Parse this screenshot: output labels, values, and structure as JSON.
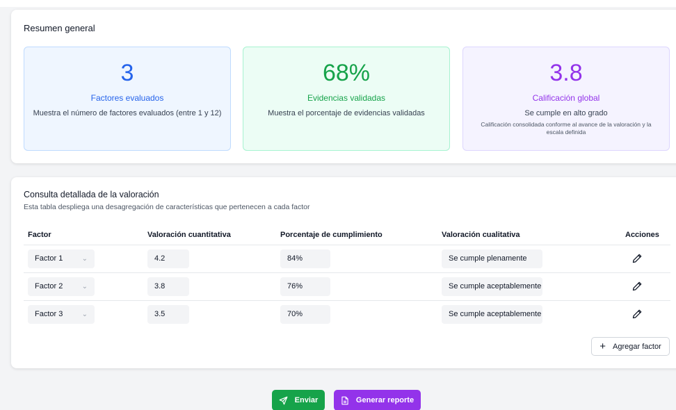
{
  "summary": {
    "title": "Resumen general",
    "stats": [
      {
        "value": "3",
        "label": "Factores evaluados",
        "desc": "Muestra el número de factores evaluados (entre 1 y 12)",
        "color": "#2563eb"
      },
      {
        "value": "68%",
        "label": "Evidencias validadas",
        "desc": "Muestra el porcentaje de evidencias validadas",
        "color": "#16a34a"
      },
      {
        "value": "3.8",
        "label": "Calificación global",
        "desc": "Se cumple en alto grado",
        "note": "Calificación consolidada conforme al avance de la valoración y la escala definida",
        "color": "#9333ea"
      }
    ]
  },
  "detail": {
    "title": "Consulta detallada de la valoración",
    "subtitle": "Esta tabla despliega una desagregación de características que pertenecen a cada factor",
    "columns": [
      "Factor",
      "Valoración cuantitativa",
      "Porcentaje de cumplimiento",
      "Valoración cualitativa",
      "Acciones"
    ],
    "rows": [
      {
        "factor": "Factor 1",
        "quant": "4.2",
        "pct": "84%",
        "qual": "Se cumple plenamente",
        "action_icon": "pencil-icon"
      },
      {
        "factor": "Factor 2",
        "quant": "3.8",
        "pct": "76%",
        "qual": "Se cumple aceptablemente",
        "action_icon": "pencil-icon"
      },
      {
        "factor": "Factor 3",
        "quant": "3.5",
        "pct": "70%",
        "qual": "Se cumple aceptablemente",
        "action_icon": "pencil-icon"
      }
    ],
    "add_button": {
      "icon": "plus-icon",
      "label": "Agregar factor"
    }
  },
  "footer": {
    "send": {
      "icon": "send-icon",
      "label": "Enviar",
      "color": "#16a34a"
    },
    "report": {
      "icon": "document-icon",
      "label": "Generar reporte",
      "color": "#9333ea"
    }
  }
}
